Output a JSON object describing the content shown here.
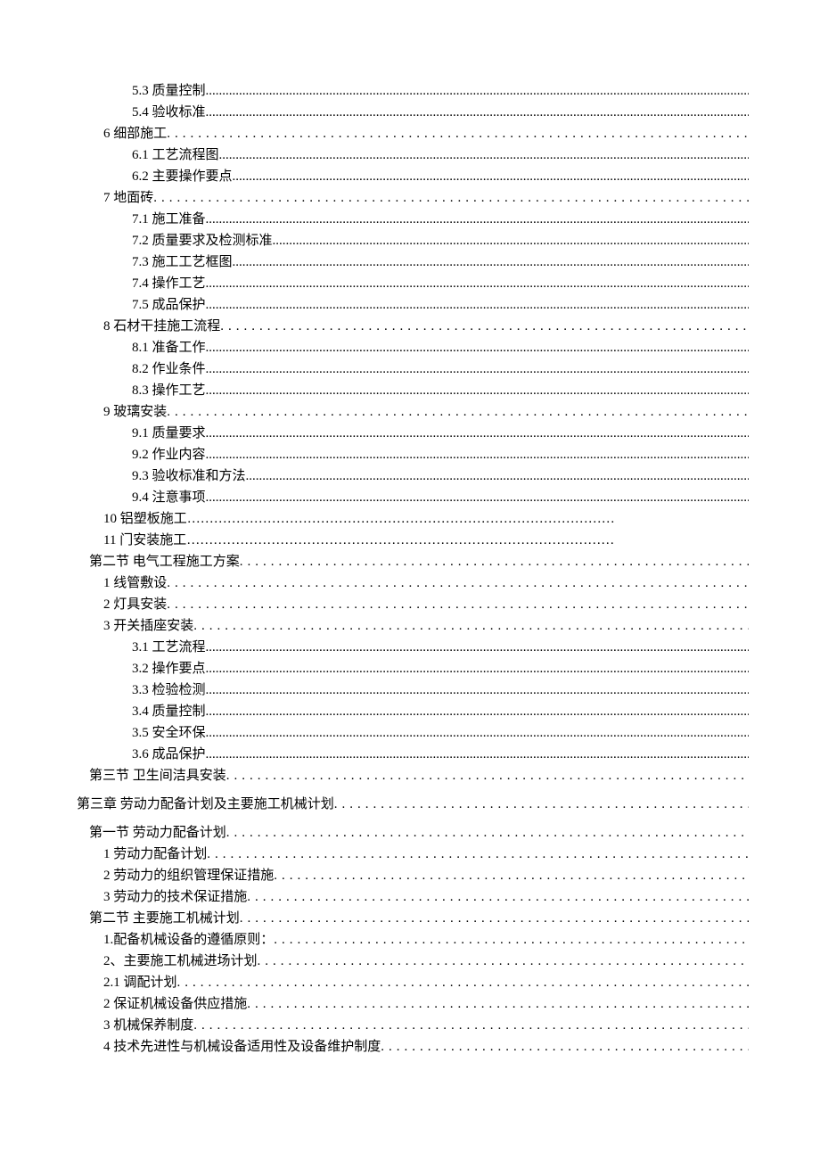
{
  "toc": [
    {
      "level": 3,
      "label": "5.3 质量控制",
      "dot": "dense"
    },
    {
      "level": 3,
      "label": "5.4 验收标准",
      "dot": "dense"
    },
    {
      "level": 2,
      "label": "6 细部施工",
      "dot": "sparse"
    },
    {
      "level": 3,
      "label": "6.1 工艺流程图",
      "dot": "dense"
    },
    {
      "level": 3,
      "label": "6.2 主要操作要点",
      "dot": "dense"
    },
    {
      "level": 2,
      "label": "7 地面砖 ",
      "dot": "sparse"
    },
    {
      "level": 3,
      "label": "7.1 施工准备",
      "dot": "dense"
    },
    {
      "level": 3,
      "label": "7.2 质量要求及检测标准",
      "dot": "dense"
    },
    {
      "level": 3,
      "label": "7.3 施工工艺框图",
      "dot": "dense"
    },
    {
      "level": 3,
      "label": "7.4 操作工艺",
      "dot": "dense"
    },
    {
      "level": 3,
      "label": "7.5 成品保护",
      "dot": "dense"
    },
    {
      "level": 2,
      "label": "8 石材干挂施工流程 ",
      "dot": "sparse"
    },
    {
      "level": 3,
      "label": "8.1 准备工作",
      "dot": "dense"
    },
    {
      "level": 3,
      "label": "8.2  作业条件",
      "dot": "dense"
    },
    {
      "level": 3,
      "label": "8.3 操作工艺",
      "dot": "dense"
    },
    {
      "level": 2,
      "label": "9 玻璃安装 ",
      "dot": "sparse"
    },
    {
      "level": 3,
      "label": "9.1 质量要求",
      "dot": "dense"
    },
    {
      "level": 3,
      "label": "9.2 作业内容",
      "dot": "dense"
    },
    {
      "level": 3,
      "label": "9.3 验收标准和方法",
      "dot": "dense"
    },
    {
      "level": 3,
      "label": "9.4 注意事项",
      "dot": "dense"
    },
    {
      "level": 2,
      "label": "10 铝塑板施工",
      "dot": "ellipsis"
    },
    {
      "level": 2,
      "label": "11 门安装施工",
      "dot": "ellipsis"
    },
    {
      "level": 1,
      "label": "第二节 电气工程施工方案",
      "dot": "sparse"
    },
    {
      "level": 2,
      "label": "1 线管敷设 ",
      "dot": "sparse"
    },
    {
      "level": 2,
      "label": "2 灯具安装 ",
      "dot": "sparse"
    },
    {
      "level": 2,
      "label": "3 开关插座安装 ",
      "dot": "sparse"
    },
    {
      "level": 3,
      "label": "3.1 工艺流程",
      "dot": "dense"
    },
    {
      "level": 3,
      "label": "3.2 操作要点",
      "dot": "dense"
    },
    {
      "level": 3,
      "label": "3.3 检验检测",
      "dot": "dense"
    },
    {
      "level": 3,
      "label": "3.4 质量控制",
      "dot": "dense"
    },
    {
      "level": 3,
      "label": "3.5 安全环保",
      "dot": "dense"
    },
    {
      "level": 3,
      "label": "3.6 成品保护",
      "dot": "dense"
    },
    {
      "level": 1,
      "label": "第三节 卫生间洁具安装",
      "dot": "sparse"
    },
    {
      "level": 0,
      "label": "第三章 劳动力配备计划及主要施工机械计划 ",
      "dot": "sparse",
      "gapBefore": true
    },
    {
      "level": 1,
      "label": "第一节 劳动力配备计划",
      "dot": "sparse",
      "gapBefore": true
    },
    {
      "level": 2,
      "label": "1 劳动力配备计划 ",
      "dot": "sparse"
    },
    {
      "level": 2,
      "label": "2 劳动力的组织管理保证措施 ",
      "dot": "sparse"
    },
    {
      "level": 2,
      "label": "3 劳动力的技术保证措施 ",
      "dot": "sparse"
    },
    {
      "level": 1,
      "label": "第二节  主要施工机械计划",
      "dot": "sparse"
    },
    {
      "level": 2,
      "label": "1.配备机械设备的遵循原则： ",
      "dot": "sparse"
    },
    {
      "level": 2,
      "label": "2、主要施工机械进场计划 ",
      "dot": "sparse"
    },
    {
      "level": 2,
      "label": "2.1 调配计划 ",
      "dot": "sparse"
    },
    {
      "level": 2,
      "label": "2 保证机械设备供应措施 ",
      "dot": "sparse"
    },
    {
      "level": 2,
      "label": "3 机械保养制度 ",
      "dot": "sparse"
    },
    {
      "level": 2,
      "label": "4 技术先进性与机械设备适用性及设备维护制度 ",
      "dot": "sparse"
    }
  ],
  "leaderDense": "........................................................................................................................................................................................................",
  "leaderSparse": "............................................................................................",
  "leaderEllipsis": "……………………………………………………………………………………"
}
